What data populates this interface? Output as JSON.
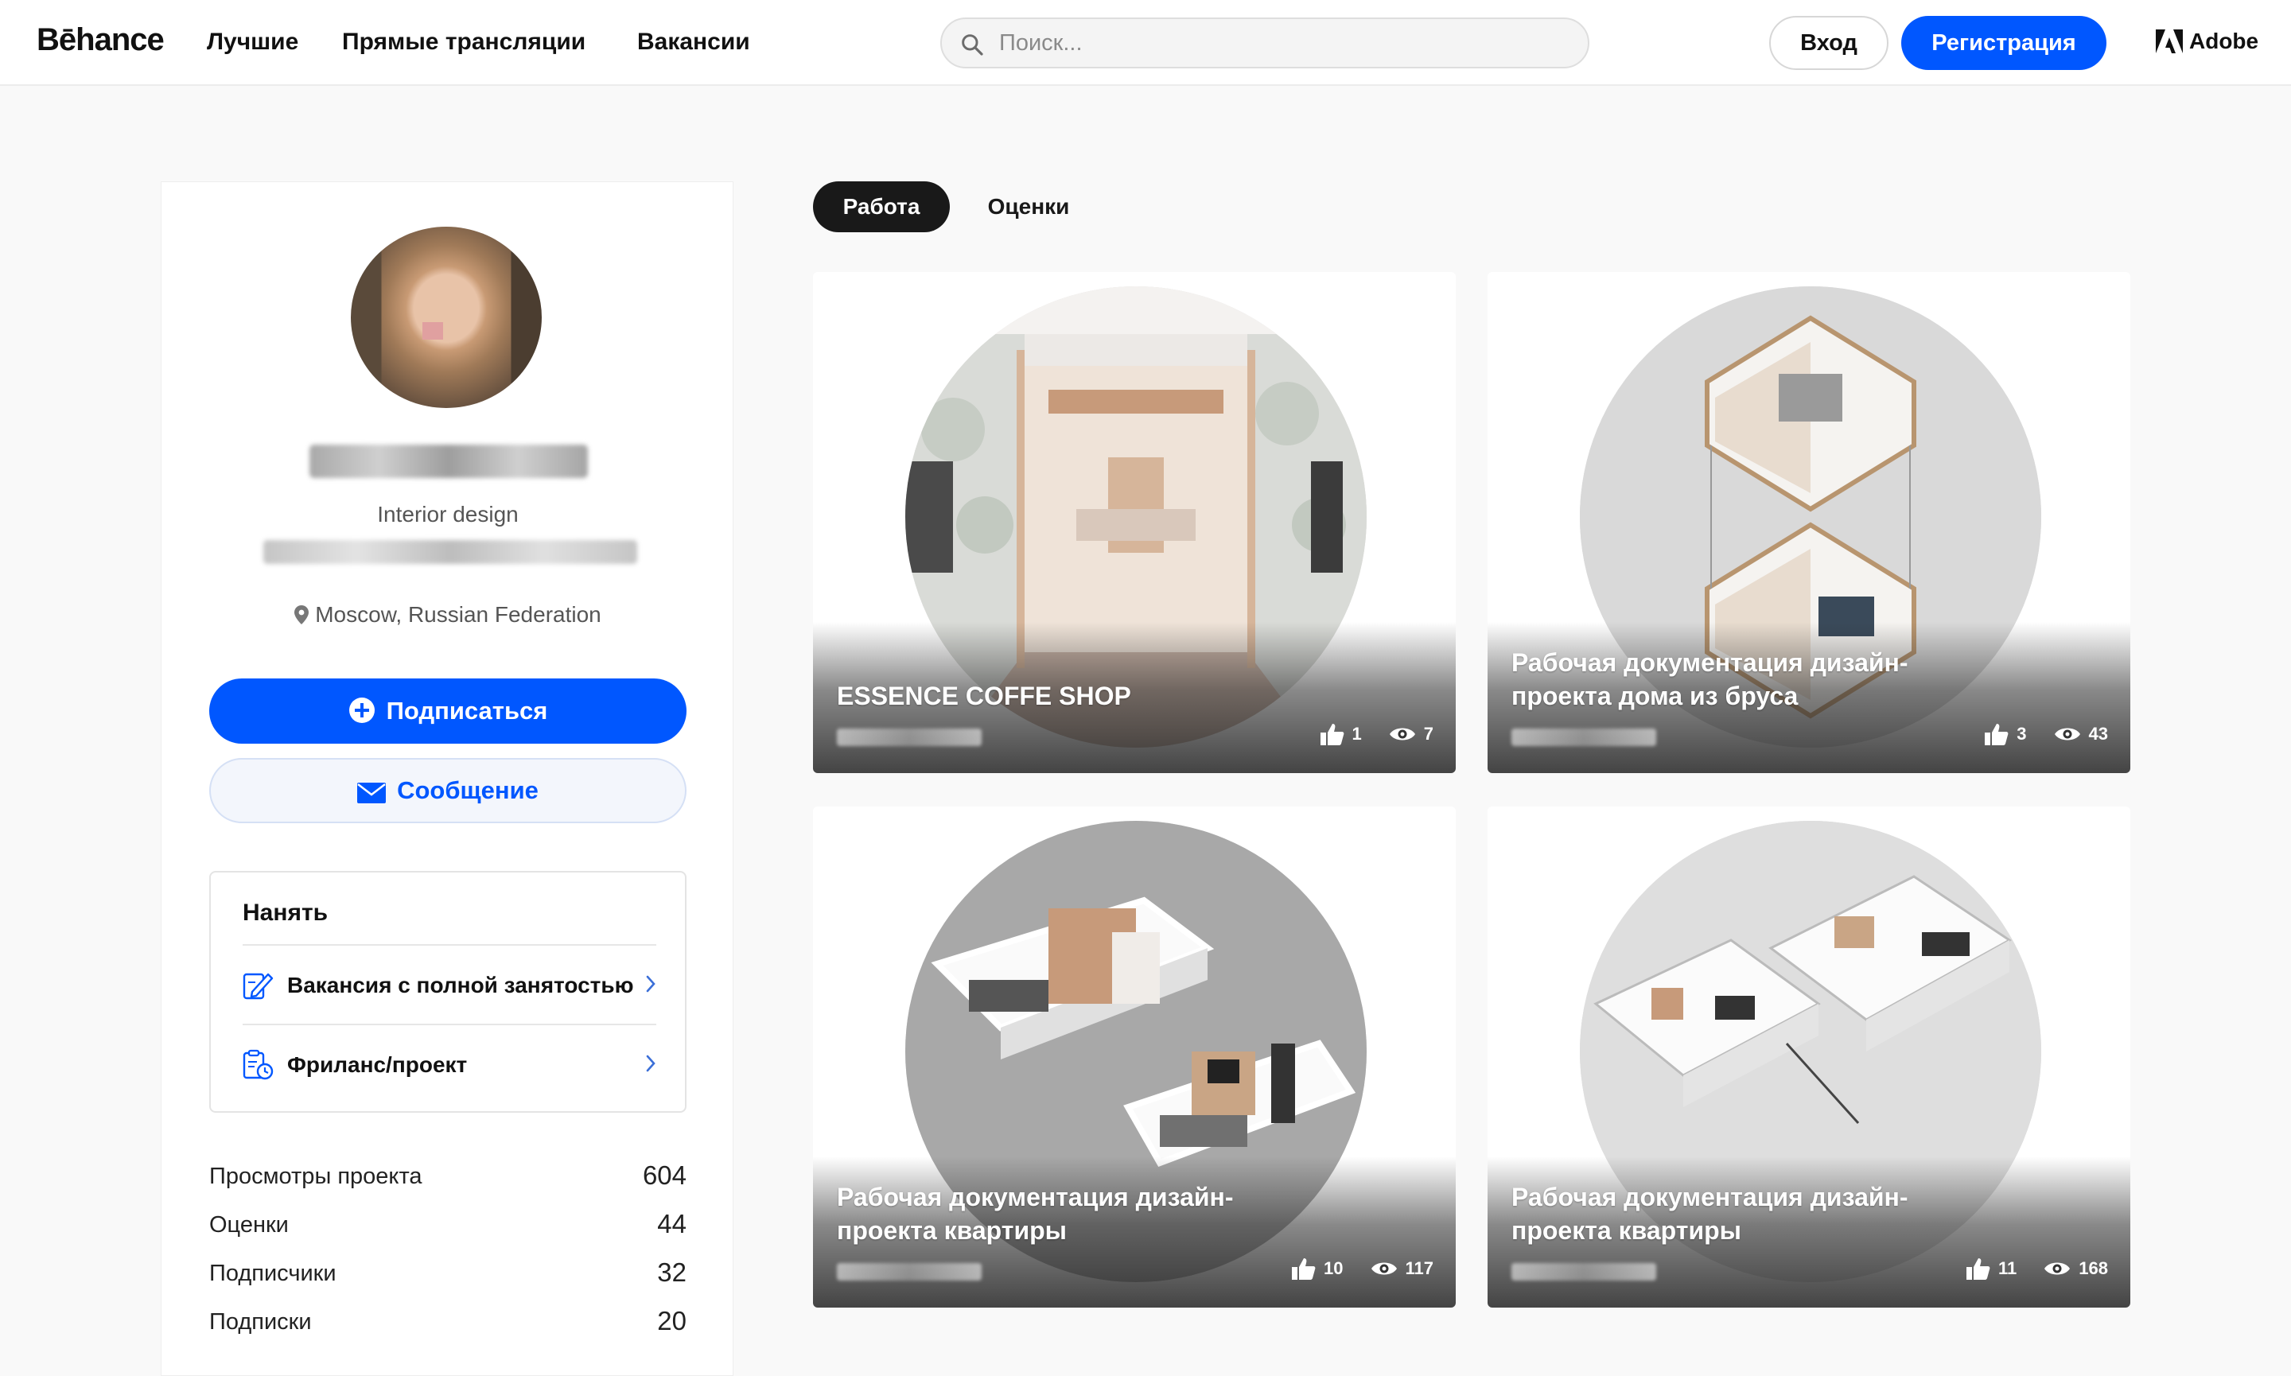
{
  "header": {
    "logo": "Bēhance",
    "nav": [
      "Лучшие",
      "Прямые трансляции",
      "Вакансии"
    ],
    "search_placeholder": "Поиск...",
    "login_label": "Вход",
    "signup_label": "Регистрация",
    "adobe_label": "Adobe"
  },
  "profile": {
    "subtitle": "Interior design",
    "location": "Moscow, Russian Federation",
    "follow_label": "Подписаться",
    "message_label": "Сообщение",
    "hire": {
      "title": "Нанять",
      "options": [
        "Вакансия с полной занятостью",
        "Фриланс/проект"
      ]
    },
    "stats": [
      {
        "label": "Просмотры проекта",
        "value": "604"
      },
      {
        "label": "Оценки",
        "value": "44"
      },
      {
        "label": "Подписчики",
        "value": "32"
      },
      {
        "label": "Подписки",
        "value": "20"
      }
    ]
  },
  "tabs": [
    "Работа",
    "Оценки"
  ],
  "projects": [
    {
      "title": "ESSENCE COFFE SHOP",
      "likes": "1",
      "views": "7"
    },
    {
      "title": "Рабочая документация дизайн-проекта дома из бруса",
      "likes": "3",
      "views": "43"
    },
    {
      "title": "Рабочая документация дизайн-проекта квартиры",
      "likes": "10",
      "views": "117"
    },
    {
      "title": "Рабочая документация дизайн-проекта квартиры",
      "likes": "11",
      "views": "168"
    }
  ],
  "colors": {
    "accent": "#0057ff",
    "dark": "#191919"
  }
}
